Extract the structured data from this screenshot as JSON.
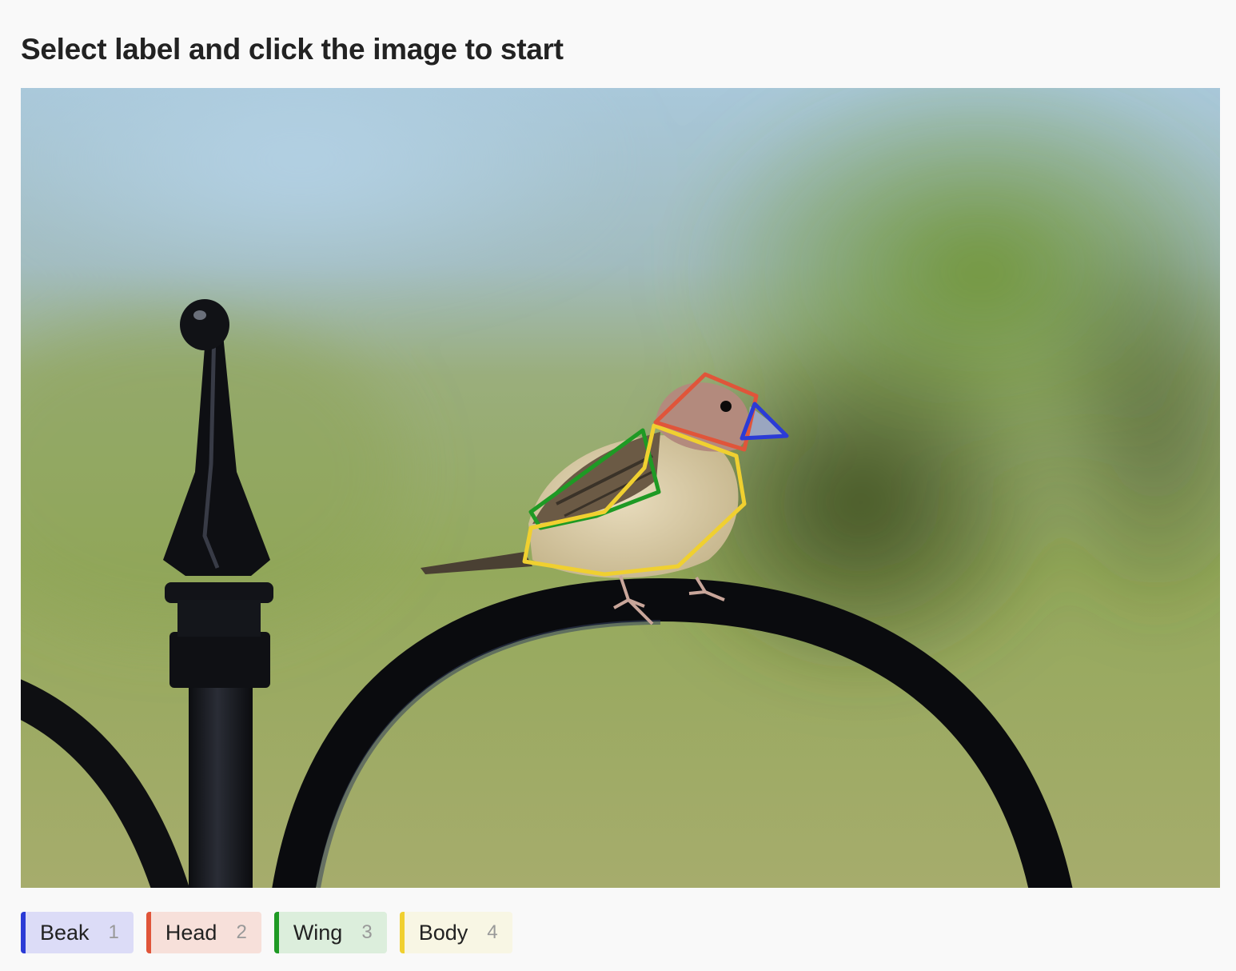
{
  "instruction": "Select label and click the image to start",
  "labels": [
    {
      "name": "Beak",
      "key": "1",
      "color": "#2b3bd6",
      "bg": "#dcdcf7"
    },
    {
      "name": "Head",
      "key": "2",
      "color": "#e0553a",
      "bg": "#f7e0da"
    },
    {
      "name": "Wing",
      "key": "3",
      "color": "#1e9a24",
      "bg": "#dceedc"
    },
    {
      "name": "Body",
      "key": "4",
      "color": "#f0d030",
      "bg": "#f8f6e4"
    }
  ]
}
